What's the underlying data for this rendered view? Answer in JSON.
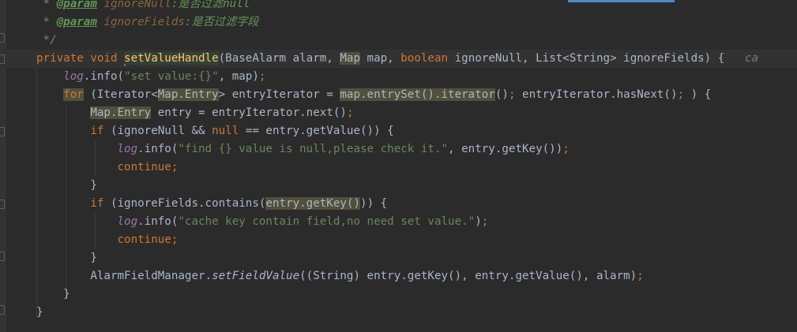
{
  "editor": {
    "language": "Java",
    "theme_colors": {
      "background": "#2b2b2b",
      "keyword": "#cc7832",
      "method_decl": "#ffc66d",
      "string": "#6a8759",
      "field": "#9876aa",
      "javadoc": "#629755",
      "plain": "#a9b7c6",
      "highlight": "#52503a",
      "caret_line": "#323232"
    },
    "lines": [
      {
        "cls": "l0",
        "tokens": [
          {
            "t": " * ",
            "c": "tok-doc"
          },
          {
            "t": "@param",
            "c": "tok-tag"
          },
          {
            "t": " ",
            "c": "tok-doc"
          },
          {
            "t": "ignoreNull",
            "c": "tok-param"
          },
          {
            "t": ":是否过滤null",
            "c": "tok-doc"
          }
        ]
      },
      {
        "cls": "l1",
        "tokens": [
          {
            "t": " * ",
            "c": "tok-doc"
          },
          {
            "t": "@param",
            "c": "tok-tag"
          },
          {
            "t": " ",
            "c": "tok-doc"
          },
          {
            "t": "ignoreFields",
            "c": "tok-param"
          },
          {
            "t": ":是否过滤字段",
            "c": "tok-doc"
          }
        ]
      },
      {
        "cls": "l2",
        "tokens": [
          {
            "t": " */",
            "c": "tok-doc"
          }
        ]
      },
      {
        "cls": "l3",
        "tokens": [
          {
            "t": "private void ",
            "c": "tok-kw"
          },
          {
            "t": "CARET",
            "c": "caret"
          },
          {
            "t": "setValueHandle",
            "c": "tok-fn tok-hl2"
          },
          {
            "t": "(BaseAlarm alarm, "
          },
          {
            "t": "Map",
            "c": "tok-hl"
          },
          {
            "t": " map, "
          },
          {
            "t": "boolean ",
            "c": "tok-kw"
          },
          {
            "t": "ignoreNull, List<String> ignoreFields) {   "
          },
          {
            "t": "ca",
            "c": "tok-hint"
          }
        ]
      },
      {
        "cls": "l4",
        "tokens": [
          {
            "t": "    "
          },
          {
            "t": "log",
            "c": "tok-log"
          },
          {
            "t": ".info("
          },
          {
            "t": "\"set value:{}\"",
            "c": "tok-str"
          },
          {
            "t": ", map)"
          },
          {
            "t": ";",
            "c": "tok-kw"
          }
        ]
      },
      {
        "cls": "l5",
        "tokens": [
          {
            "t": "    "
          },
          {
            "t": "for",
            "c": "tok-kw tok-hl"
          },
          {
            "t": " (Iterator<"
          },
          {
            "t": "Map.Entry",
            "c": "tok-hl"
          },
          {
            "t": "> entryIterator = "
          },
          {
            "t": "map.entrySet().iterator",
            "c": "tok-hl"
          },
          {
            "t": "()"
          },
          {
            "t": "; ",
            "c": "tok-kw"
          },
          {
            "t": "entryIterator.hasNext()"
          },
          {
            "t": "; ",
            "c": "tok-kw"
          },
          {
            "t": ") {"
          }
        ]
      },
      {
        "cls": "l6",
        "tokens": [
          {
            "t": "        "
          },
          {
            "t": "Map.Entry",
            "c": "tok-hl"
          },
          {
            "t": " entry = entryIterator.next()"
          },
          {
            "t": ";",
            "c": "tok-kw"
          }
        ]
      },
      {
        "cls": "l7",
        "tokens": [
          {
            "t": "        "
          },
          {
            "t": "if ",
            "c": "tok-kw"
          },
          {
            "t": "(ignoreNull && "
          },
          {
            "t": "null ",
            "c": "tok-kw"
          },
          {
            "t": "== entry.getValue()) {"
          }
        ]
      },
      {
        "cls": "l8",
        "tokens": [
          {
            "t": "            "
          },
          {
            "t": "log",
            "c": "tok-log"
          },
          {
            "t": ".info("
          },
          {
            "t": "\"find {} value is null,please check it.\"",
            "c": "tok-str"
          },
          {
            "t": ", entry.getKey())"
          },
          {
            "t": ";",
            "c": "tok-kw"
          }
        ]
      },
      {
        "cls": "l9",
        "tokens": [
          {
            "t": "            "
          },
          {
            "t": "continue;",
            "c": "tok-kw"
          }
        ]
      },
      {
        "cls": "l10",
        "tokens": [
          {
            "t": "        }"
          }
        ]
      },
      {
        "cls": "l11",
        "tokens": [
          {
            "t": "        "
          },
          {
            "t": "if ",
            "c": "tok-kw"
          },
          {
            "t": "(ignoreFields.contains("
          },
          {
            "t": "entry.getKey()",
            "c": "tok-hl"
          },
          {
            "t": ")) {"
          }
        ]
      },
      {
        "cls": "l12",
        "tokens": [
          {
            "t": "            "
          },
          {
            "t": "log",
            "c": "tok-log"
          },
          {
            "t": ".info("
          },
          {
            "t": "\"cache key contain field,no need set value.\"",
            "c": "tok-str"
          },
          {
            "t": ")"
          },
          {
            "t": ";",
            "c": "tok-kw"
          }
        ]
      },
      {
        "cls": "l13",
        "tokens": [
          {
            "t": "            "
          },
          {
            "t": "continue;",
            "c": "tok-kw"
          }
        ]
      },
      {
        "cls": "l14",
        "tokens": [
          {
            "t": "        }"
          }
        ]
      },
      {
        "cls": "l15",
        "tokens": [
          {
            "t": "        AlarmFieldManager."
          },
          {
            "t": "setFieldValue",
            "c": "tok-static"
          },
          {
            "t": "((String) entry.getKey(), entry.getValue(), alarm)"
          },
          {
            "t": ";",
            "c": "tok-kw"
          }
        ]
      },
      {
        "cls": "l16",
        "tokens": [
          {
            "t": "    }"
          }
        ]
      },
      {
        "cls": "l17",
        "tokens": [
          {
            "t": "}"
          }
        ]
      }
    ]
  }
}
